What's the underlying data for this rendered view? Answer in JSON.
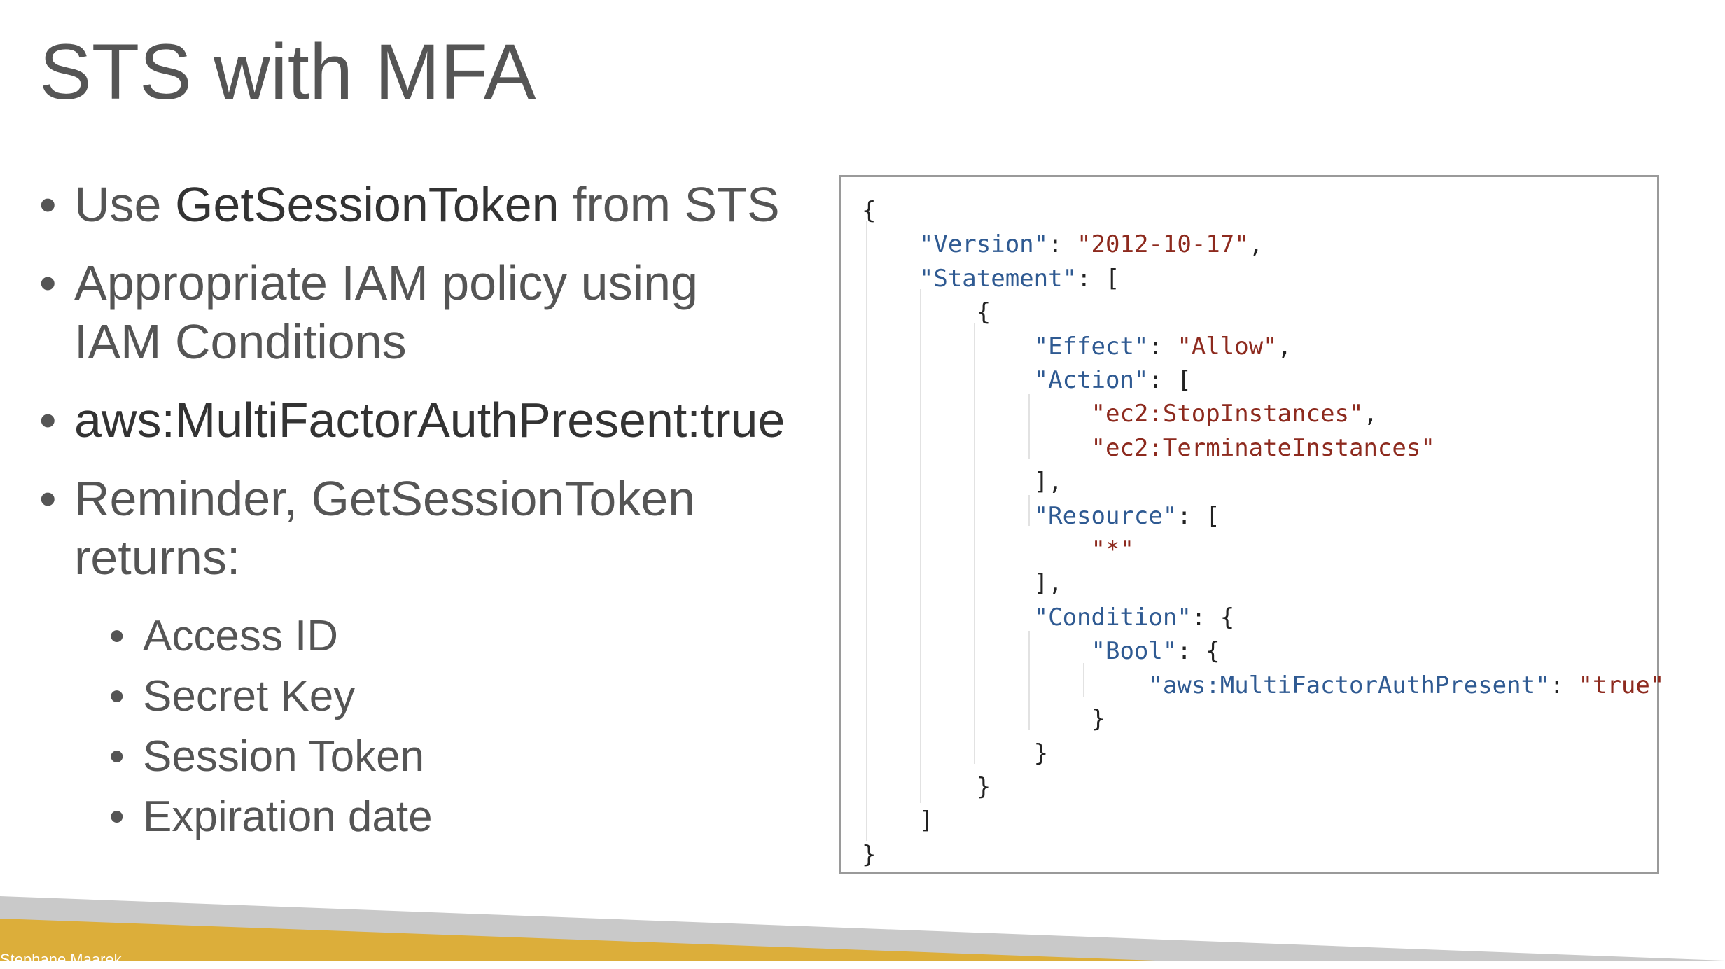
{
  "slide": {
    "title": "STS with MFA"
  },
  "bullets": {
    "b1": {
      "prefix": "Use ",
      "emphasis": "GetSessionToken",
      "suffix": " from STS"
    },
    "b2": {
      "line1": "Appropriate IAM policy using",
      "line2": "IAM Conditions"
    },
    "b3": {
      "text": "aws:MultiFactorAuthPresent:true"
    },
    "b4": {
      "line1": "Reminder, GetSessionToken",
      "line2": "returns:"
    },
    "returns": [
      "Access ID",
      "Secret Key",
      "Session Token",
      "Expiration date"
    ]
  },
  "policy": {
    "version_key": "\"Version\"",
    "version_val": "\"2012-10-17\"",
    "statement_key": "\"Statement\"",
    "effect_key": "\"Effect\"",
    "effect_val": "\"Allow\"",
    "action_key": "\"Action\"",
    "action_1": "\"ec2:StopInstances\"",
    "action_2": "\"ec2:TerminateInstances\"",
    "resource_key": "\"Resource\"",
    "resource_val": "\"*\"",
    "condition_key": "\"Condition\"",
    "bool_key": "\"Bool\"",
    "mfa_key": "\"aws:MultiFactorAuthPresent\"",
    "mfa_val": "\"true\""
  },
  "footer": {
    "text": "Stephane Maarek"
  },
  "colors": {
    "band_gold": "#dcae3a",
    "band_grey": "#c9c9c9",
    "json_key": "#2f5a92",
    "json_string": "#8d2a1e"
  }
}
